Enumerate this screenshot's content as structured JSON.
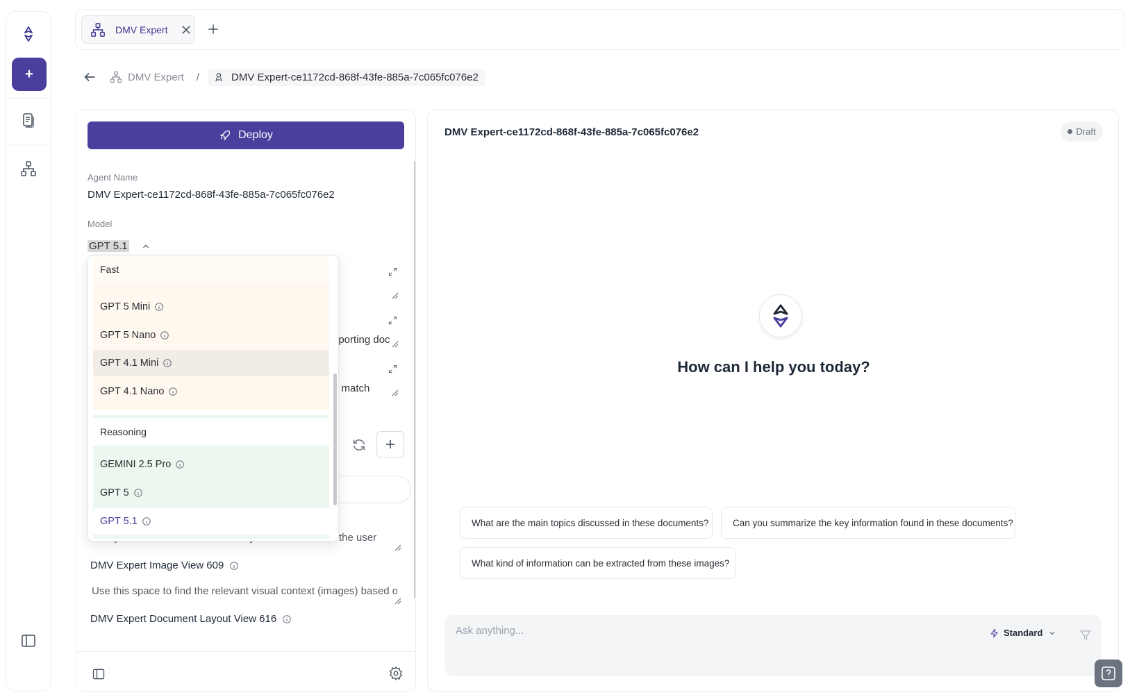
{
  "tab": {
    "label": "DMV Expert"
  },
  "breadcrumb": {
    "parent": "DMV Expert",
    "separator": "/",
    "current": "DMV Expert-ce1172cd-868f-43fe-885a-7c065fc076e2"
  },
  "left_panel": {
    "deploy_label": "Deploy",
    "agent_name_label": "Agent Name",
    "agent_name_value": "DMV Expert-ce1172cd-868f-43fe-885a-7c065fc076e2",
    "model_label": "Model",
    "model_value": "GPT 5.1",
    "peek_text_1": "pporting doc",
    "peek_text_2": "o match",
    "tools": [
      {
        "description": "Always use this to find semantically similar context to the user"
      },
      {
        "name": "DMV Expert Image View 609",
        "description": "Use this space to find the relevant visual context (images) based on"
      },
      {
        "name": "DMV Expert Document Layout View 616"
      }
    ]
  },
  "model_dropdown": {
    "groups": [
      {
        "header": "Fast",
        "options": [
          "GPT 5 Mini",
          "GPT 5 Nano",
          "GPT 4.1 Mini",
          "GPT 4.1 Nano"
        ]
      },
      {
        "header": "Reasoning",
        "options": [
          "GEMINI 2.5 Pro",
          "GPT 5",
          "GPT 5.1"
        ]
      }
    ],
    "hovered": "GPT 4.1 Mini",
    "selected": "GPT 5.1"
  },
  "chat": {
    "title": "DMV Expert-ce1172cd-868f-43fe-885a-7c065fc076e2",
    "status": "Draft",
    "greeting": "How can I help you today?",
    "suggestions": [
      "What are the main topics discussed in these documents?",
      "Can you summarize the key information found in these documents?",
      "What kind of information can be extracted from these images?"
    ],
    "input_placeholder": "Ask anything...",
    "mode": "Standard"
  },
  "colors": {
    "accent": "#4b3f9e",
    "fast_group_bg": "#fff8ef",
    "reasoning_group_bg": "#ecf8ef"
  }
}
